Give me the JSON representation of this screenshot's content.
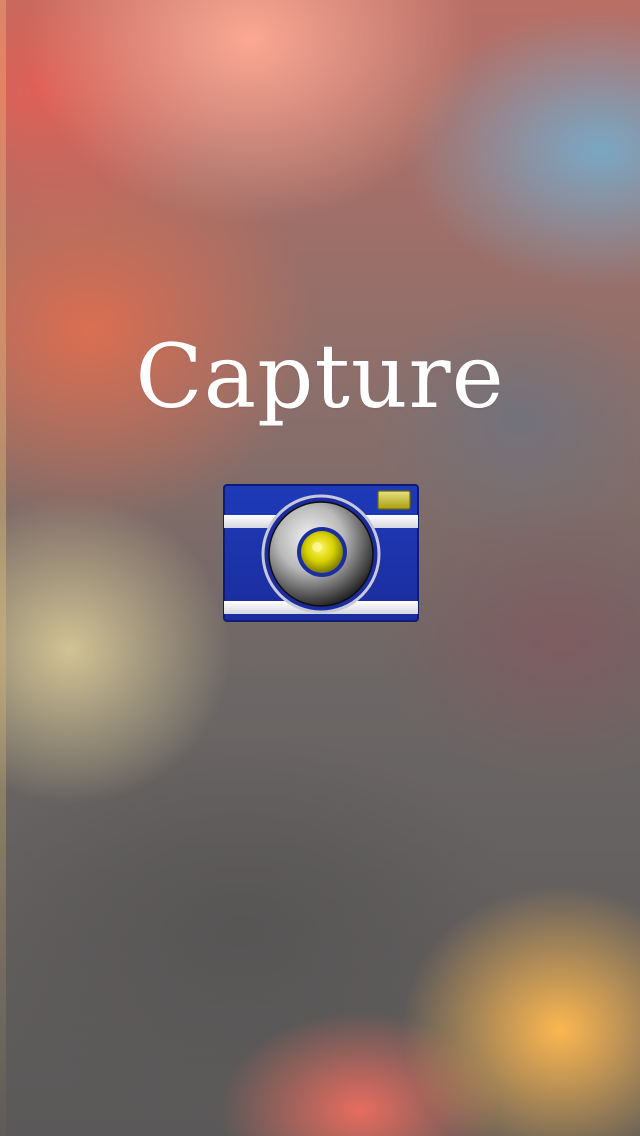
{
  "app": {
    "title": "Capture",
    "icon": "camera-icon"
  },
  "colors": {
    "camera_body": "#1f33ad",
    "camera_stripe": "#e6e6ee",
    "camera_lens_ring": "#2a2a2a",
    "camera_lens_center": "#d6d000",
    "camera_flash": "#c8c020"
  }
}
